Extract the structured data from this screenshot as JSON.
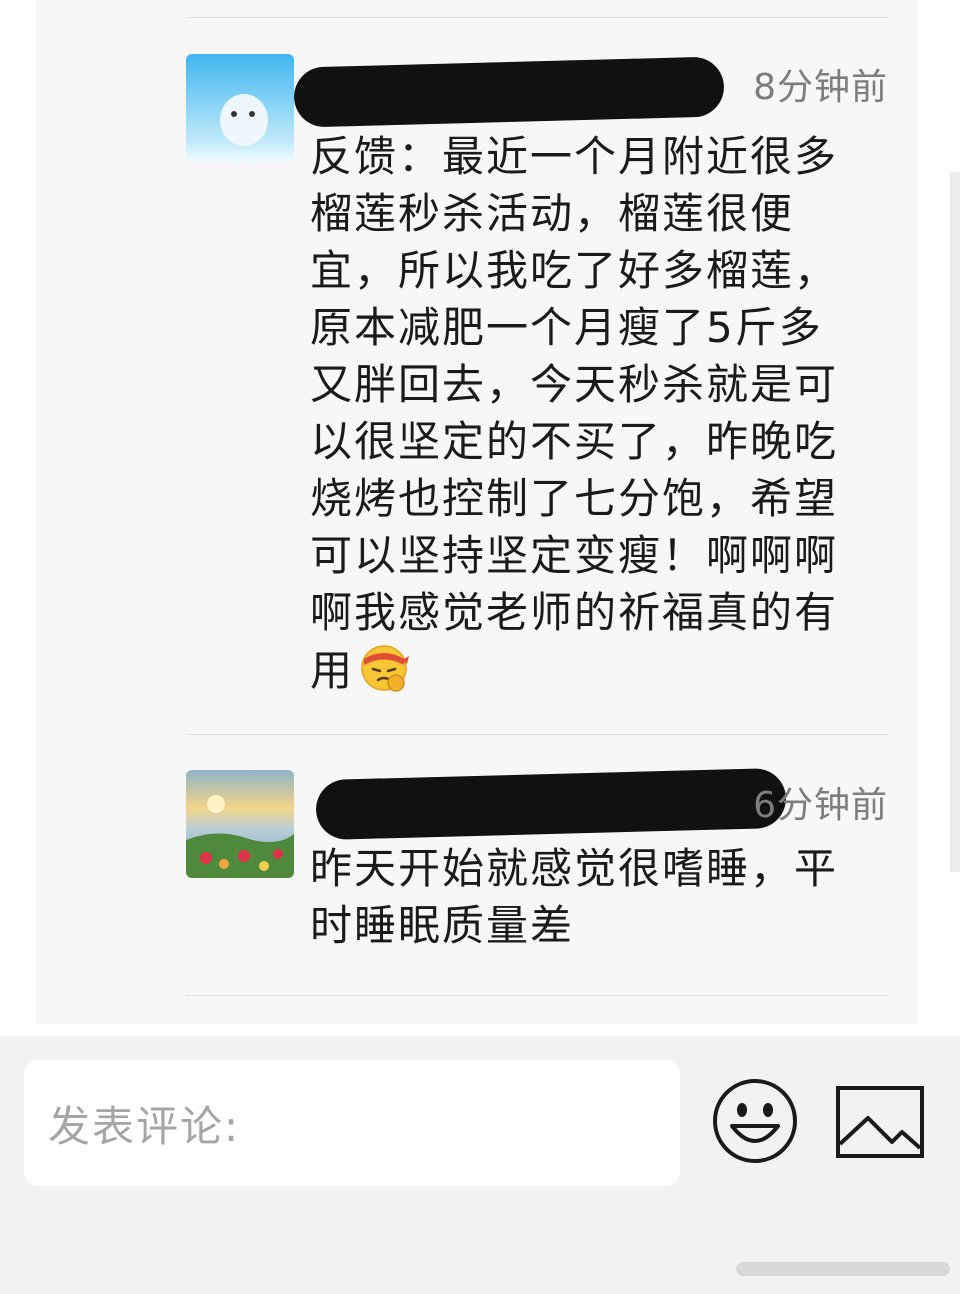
{
  "comments": [
    {
      "time": "8分钟前",
      "text_lines": [
        "反馈：最近一个月附近很多",
        "榴莲秒杀活动，榴莲很便",
        "宜，所以我吃了好多榴莲，",
        "原本减肥一个月瘦了5斤多",
        "又胖回去，今天秒杀就是可",
        "以很坚定的不买了，昨晚吃",
        "烧烤也控制了七分饱，希望",
        "可以坚持坚定变瘦！啊啊啊",
        "啊我感觉老师的祈福真的有",
        "用"
      ],
      "emoji": "determined-face-emoji"
    },
    {
      "time": "6分钟前",
      "text_lines": [
        "昨天开始就感觉很嗜睡，平",
        "时睡眠质量差"
      ]
    }
  ],
  "composer": {
    "placeholder": "发表评论:",
    "emoji_icon": "smiley-icon",
    "image_icon": "image-icon"
  },
  "colors": {
    "panel_bg": "#f7f7f7",
    "bottom_bar_bg": "#f2f2f2",
    "timestamp": "#7d7d7d",
    "placeholder": "#a6a6a6"
  }
}
